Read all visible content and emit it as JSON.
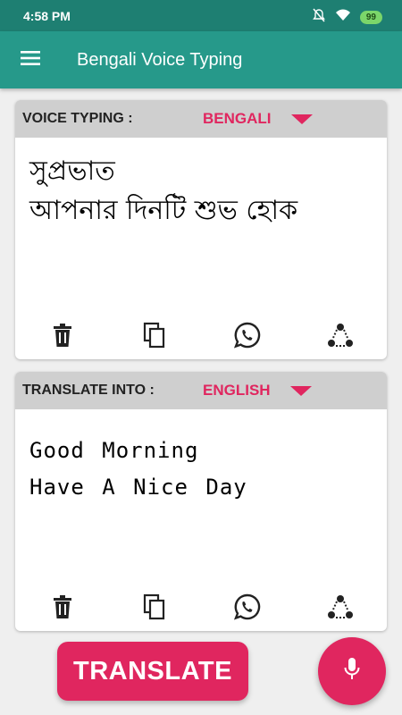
{
  "status_bar": {
    "time": "4:58 PM",
    "battery": "99",
    "icons": [
      "mute-icon",
      "wifi-icon",
      "battery-icon"
    ]
  },
  "app_bar": {
    "title": "Bengali Voice Typing",
    "menu_icon": "hamburger-menu-icon"
  },
  "voice_card": {
    "label": "VOICE TYPING :",
    "language": "BENGALI",
    "text": "সুপ্রভাত\nআপনার দিনটি শুভ হোক",
    "actions": [
      "delete-icon",
      "copy-icon",
      "whatsapp-icon",
      "share-icon"
    ]
  },
  "translate_card": {
    "label": "TRANSLATE INTO :",
    "language": "ENGLISH",
    "text": "Good Morning\nHave A Nice Day",
    "actions": [
      "delete-icon",
      "copy-icon",
      "whatsapp-icon",
      "share-icon"
    ]
  },
  "bottom": {
    "translate_label": "TRANSLATE",
    "mic_icon": "microphone-icon"
  },
  "colors": {
    "status_bar": "#1e7f72",
    "app_bar": "#26998a",
    "accent": "#e0265f",
    "card_header": "#cfcfcf",
    "background": "#efefef"
  }
}
